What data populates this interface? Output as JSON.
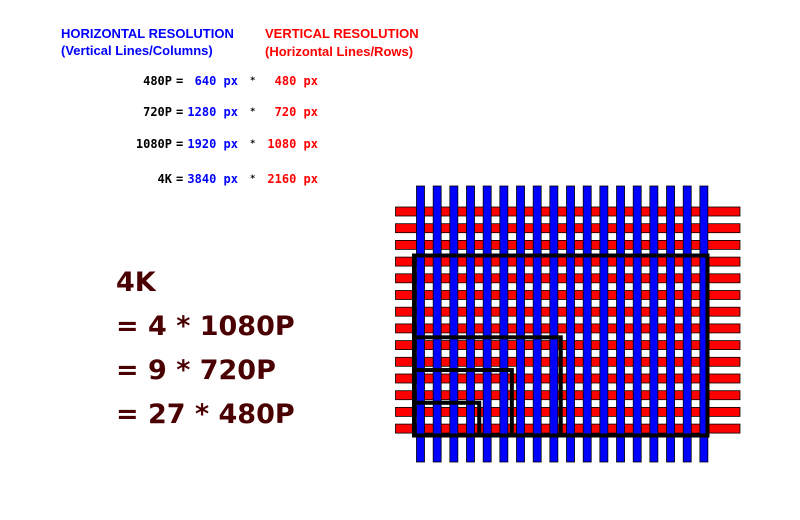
{
  "headers": {
    "horizontal": {
      "title": "HORIZONTAL RESOLUTION",
      "subtitle": "(Vertical Lines/Columns)",
      "color": "#0000ff"
    },
    "vertical": {
      "title": "VERTICAL RESOLUTION",
      "subtitle": "(Horizontal Lines/Rows)",
      "color": "#ff0000"
    }
  },
  "resolutions": [
    {
      "name": "480P",
      "eq": "=",
      "horizontal": "640 px",
      "op": "*",
      "vertical": "480 px"
    },
    {
      "name": "720P",
      "eq": "=",
      "horizontal": "1280 px",
      "op": "*",
      "vertical": "720 px"
    },
    {
      "name": "1080P",
      "eq": "=",
      "horizontal": "1920 px",
      "op": "*",
      "vertical": "1080 px"
    },
    {
      "name": "4K",
      "eq": "=",
      "horizontal": "3840 px",
      "op": "*",
      "vertical": "2160 px"
    }
  ],
  "formula": {
    "lines": [
      "4K",
      "= 4 * 1080P",
      "= 9 * 720P",
      "= 27 * 480P"
    ],
    "color": "#4a0000"
  },
  "diagram": {
    "columns": 18,
    "rows": 14,
    "column_color": "#0000ff",
    "row_color": "#ff0000",
    "outline_color": "#000000",
    "regions": [
      {
        "name": "4K",
        "cols": 18,
        "rows": 11
      },
      {
        "name": "1080P",
        "cols": 9,
        "rows": 6
      },
      {
        "name": "720P",
        "cols": 6,
        "rows": 4
      },
      {
        "name": "480P",
        "cols": 4,
        "rows": 2
      }
    ]
  }
}
